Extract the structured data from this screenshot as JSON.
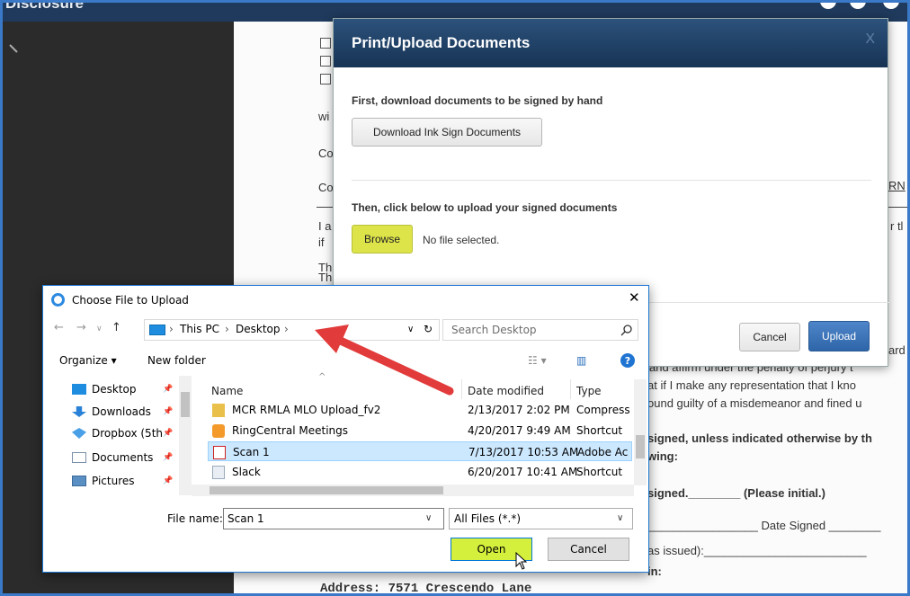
{
  "window": {
    "title": "Disclosure"
  },
  "background_doc": {
    "lines": [
      {
        "id": "w",
        "text": "wi"
      },
      {
        "id": "co1",
        "text": "Co"
      },
      {
        "id": "co2",
        "text": "Co"
      },
      {
        "id": "rn",
        "text": "RN"
      },
      {
        "id": "ia",
        "text": "I a"
      },
      {
        "id": "if",
        "text": "if"
      },
      {
        "id": "rt",
        "text": "r tl"
      },
      {
        "id": "th1",
        "text": "Th"
      },
      {
        "id": "th2",
        "text": "Th"
      },
      {
        "id": "ard",
        "text": "ard"
      },
      {
        "id": "under",
        "text": "and affirm under the penalty of perjury t"
      },
      {
        "id": "repr",
        "text": "at if I make any representation that I kno"
      },
      {
        "id": "guilty",
        "text": "ound guilty of a misdemeanor and fined u"
      },
      {
        "id": "signed_line",
        "text": "signed, unless indicated otherwise by th"
      },
      {
        "id": "wing",
        "text": "wing:"
      },
      {
        "id": "initial",
        "text": "signed.________ (Please initial.)"
      },
      {
        "id": "date_signed",
        "text": "_________________ Date Signed ________"
      },
      {
        "id": "issued",
        "text": "as issued):_________________________"
      },
      {
        "id": "in",
        "text": "in:"
      },
      {
        "id": "address",
        "text": "Address: 7571 Crescendo Lane"
      }
    ]
  },
  "modal": {
    "title": "Print/Upload Documents",
    "close_label": "X",
    "step1_label": "First, download documents to be signed by hand",
    "download_button": "Download Ink Sign Documents",
    "step2_label": "Then, click below to upload your signed documents",
    "browse_button": "Browse",
    "no_file_text": "No file selected.",
    "cancel_button": "Cancel",
    "upload_button": "Upload",
    "colors": {
      "header": "#1f3f66",
      "browse": "#dde44a",
      "upload": "#3a74b9"
    }
  },
  "file_dialog": {
    "title": "Choose File to Upload",
    "close_label": "✕",
    "breadcrumb": [
      "This PC",
      "Desktop"
    ],
    "search_placeholder": "Search Desktop",
    "toolbar": {
      "organize": "Organize ▾",
      "new_folder": "New folder"
    },
    "sidebar": [
      {
        "label": "Desktop",
        "icon": "desktop-icon"
      },
      {
        "label": "Downloads",
        "icon": "download-icon"
      },
      {
        "label": "Dropbox (5th",
        "icon": "dropbox-icon"
      },
      {
        "label": "Documents",
        "icon": "documents-icon"
      },
      {
        "label": "Pictures",
        "icon": "pictures-icon"
      }
    ],
    "columns": {
      "name": "Name",
      "date": "Date modified",
      "type": "Type"
    },
    "files": [
      {
        "name": "MCR RMLA MLO Upload_fv2",
        "date": "2/13/2017 2:02 PM",
        "type": "Compress",
        "icon": "zip-folder-icon"
      },
      {
        "name": "RingCentral Meetings",
        "date": "4/20/2017 9:49 AM",
        "type": "Shortcut",
        "icon": "ringcentral-icon"
      },
      {
        "name": "Scan 1",
        "date": "7/13/2017 10:53 AM",
        "type": "Adobe Ac",
        "icon": "pdf-icon"
      },
      {
        "name": "Slack",
        "date": "6/20/2017 10:41 AM",
        "type": "Shortcut",
        "icon": "shortcut-icon"
      }
    ],
    "selected_file": "Scan 1",
    "file_name_label": "File name:",
    "file_name_value": "Scan 1",
    "file_type_filter": "All Files (*.*)",
    "open_button": "Open",
    "cancel_button": "Cancel",
    "colors": {
      "open_highlight": "#d4ef3c",
      "selected_row": "#cce8ff"
    }
  }
}
